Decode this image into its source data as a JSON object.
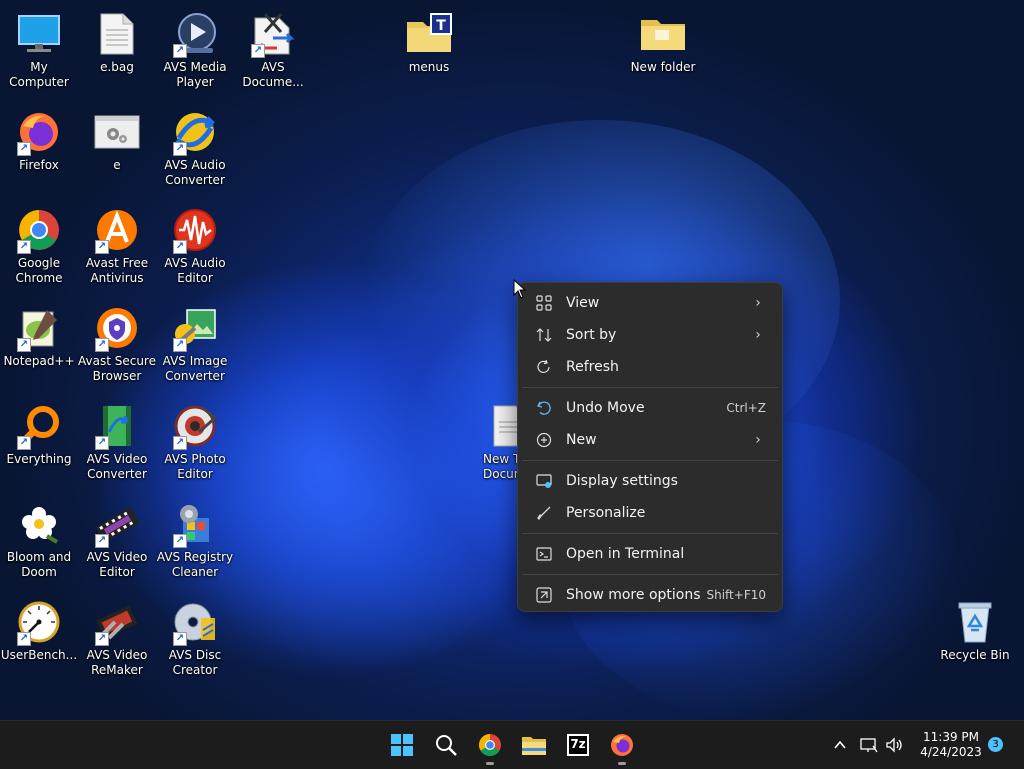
{
  "desktop": {
    "icons": [
      {
        "label": "My Computer"
      },
      {
        "label": "e.bag"
      },
      {
        "label": "AVS Media\nPlayer"
      },
      {
        "label": "AVS\nDocume..."
      },
      {
        "label": "menus"
      },
      {
        "label": "New folder"
      },
      {
        "label": "Firefox"
      },
      {
        "label": "e"
      },
      {
        "label": "AVS Audio\nConverter"
      },
      {
        "label": "Google\nChrome"
      },
      {
        "label": "Avast Free\nAntivirus"
      },
      {
        "label": "AVS Audio\nEditor"
      },
      {
        "label": "Notepad++"
      },
      {
        "label": "Avast Secure\nBrowser"
      },
      {
        "label": "AVS Image\nConverter"
      },
      {
        "label": "Everything"
      },
      {
        "label": "AVS Video\nConverter"
      },
      {
        "label": "AVS Photo\nEditor"
      },
      {
        "label": "Bloom and\nDoom"
      },
      {
        "label": "AVS Video\nEditor"
      },
      {
        "label": "AVS Registry\nCleaner"
      },
      {
        "label": "UserBench..."
      },
      {
        "label": "AVS Video\nReMaker"
      },
      {
        "label": "AVS Disc\nCreator"
      },
      {
        "label": "New Te\nDocum"
      },
      {
        "label": "Recycle Bin"
      }
    ]
  },
  "context_menu": {
    "items": [
      {
        "label": "View",
        "icon": "grid-icon"
      },
      {
        "label": "Sort by",
        "icon": "sort-icon"
      },
      {
        "label": "Refresh",
        "icon": "refresh-icon"
      },
      {
        "label": "Undo Move",
        "shortcut": "Ctrl+Z",
        "icon": "undo-icon"
      },
      {
        "label": "New",
        "icon": "plus-circle-icon"
      },
      {
        "label": "Display settings",
        "icon": "display-icon"
      },
      {
        "label": "Personalize",
        "icon": "brush-icon"
      },
      {
        "label": "Open in Terminal",
        "icon": "terminal-icon"
      },
      {
        "label": "Show more options",
        "shortcut": "Shift+F10",
        "icon": "more-options-icon"
      }
    ],
    "arrow_glyph": "›"
  },
  "taskbar": {
    "time": "11:39 PM",
    "date": "4/24/2023",
    "notification_count": "3",
    "seven_zip_label": "7z"
  },
  "colors": {
    "accent": "#4cc2ff",
    "menu_bg": "#2c2c2c",
    "taskbar_bg": "#1c1c1c"
  }
}
